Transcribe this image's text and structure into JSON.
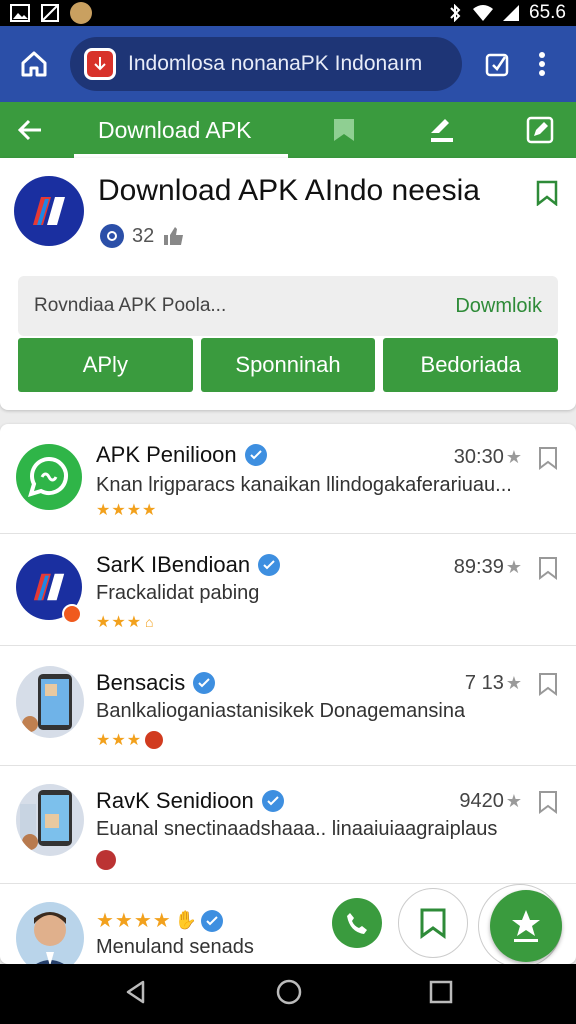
{
  "status_bar": {
    "time": "65.6",
    "icons": [
      "image-icon",
      "no-sim-icon",
      "avatar-icon",
      "bluetooth-icon",
      "wifi-icon",
      "signal-icon"
    ]
  },
  "browser": {
    "url_text": "Indomlosa nonanаPK Indonaım",
    "home_icon": "home-icon",
    "tabs_icon": "tabs-icon",
    "menu_icon": "more-vert-icon"
  },
  "toolbar": {
    "tab_label": "Download APK",
    "icons": [
      "back-arrow-icon",
      "bookmark-icon",
      "share-icon",
      "edit-icon"
    ]
  },
  "header": {
    "title": "Download APK AIndo neesia",
    "rating_count": "32",
    "search_placeholder": "Rovndiaa APK Poola...",
    "search_action": "Dowmloik",
    "buttons": [
      "APly",
      "Sponninah",
      "Bedoriada"
    ]
  },
  "list": [
    {
      "name": "APK Penilioon",
      "subtitle": "Knan lrigparacs kanaikan llindogakaferariuau...",
      "count": "30:30",
      "stars": "★★★★",
      "avatar": "whatsapp-icon"
    },
    {
      "name": "SarK IBendioan",
      "subtitle": "Frackalidat  pabing",
      "count": "89:39",
      "stars": "★★★",
      "avatar": "app-logo"
    },
    {
      "name": "Bensacis",
      "subtitle": "Banlkalioganiastanisikek Donagemansina",
      "count": "7 13",
      "stars": "★★★",
      "avatar": "phone-screenshot"
    },
    {
      "name": "RavK Senidioon",
      "subtitle": "Euanal snectinaadshaaa.. linaaiuiaagraiplaus",
      "count": "9420",
      "stars": "",
      "avatar": "phone-screenshot"
    },
    {
      "name": "",
      "subtitle": "Menuland  senads",
      "count": "",
      "stars": "★★★★",
      "avatar": "person-photo"
    }
  ],
  "colors": {
    "browser_blue": "#2b4fa8",
    "green": "#3a9b3e",
    "star_orange": "#f2a11d"
  }
}
